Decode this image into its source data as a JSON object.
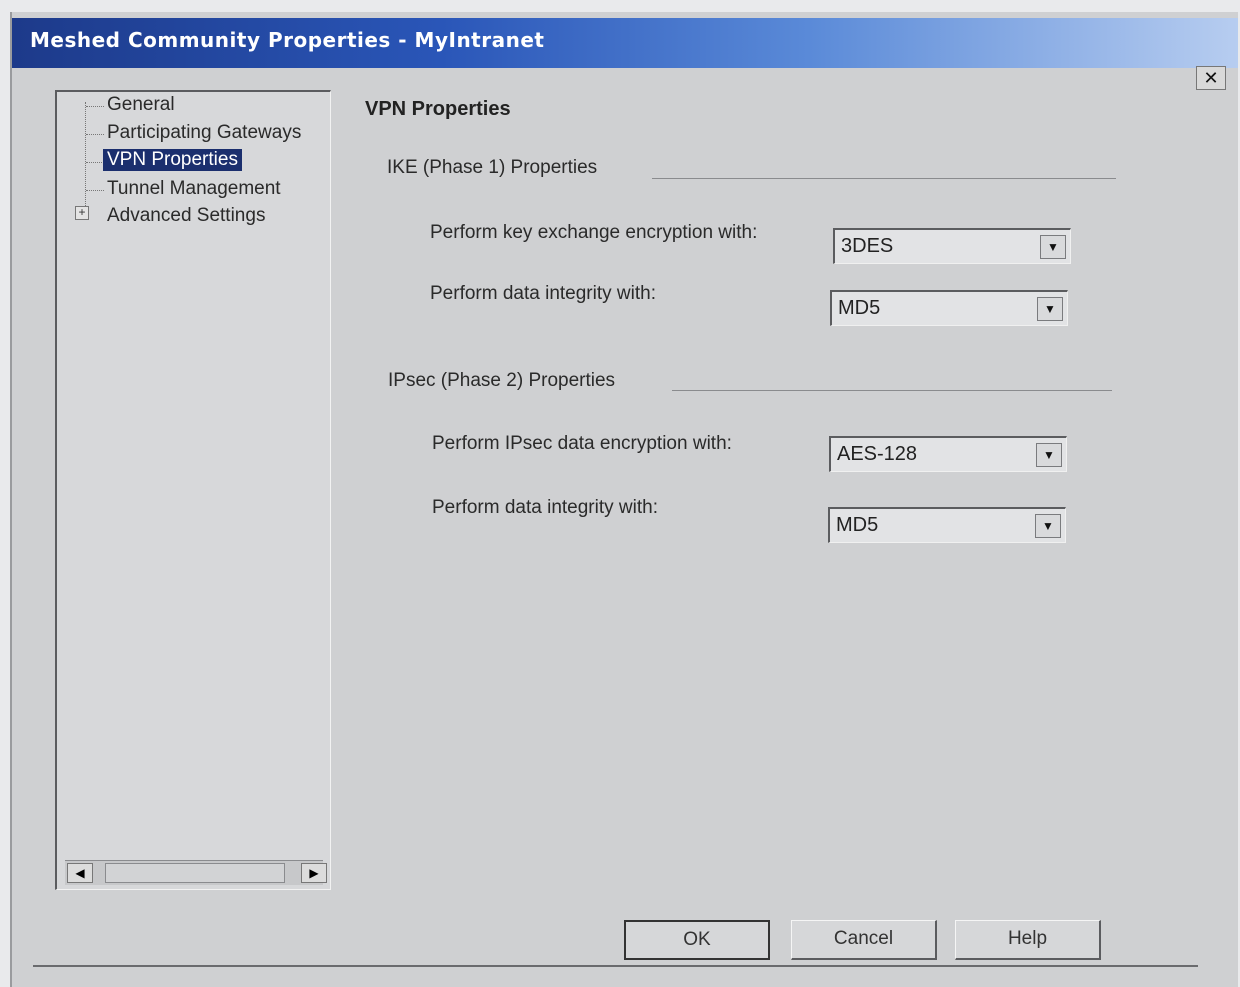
{
  "window": {
    "title": "Meshed Community Properties - MyIntranet",
    "close_label": "✕"
  },
  "tree": {
    "items": [
      {
        "label": "General"
      },
      {
        "label": "Participating Gateways"
      },
      {
        "label": "VPN Properties",
        "selected": true
      },
      {
        "label": "Tunnel Management"
      },
      {
        "label": "Advanced Settings",
        "expander": "+"
      }
    ],
    "scroll_left": "◀",
    "scroll_right": "▶"
  },
  "main": {
    "heading": "VPN Properties",
    "ike": {
      "title": "IKE (Phase 1) Properties",
      "encryption_label": "Perform key exchange encryption with:",
      "encryption_value": "3DES",
      "integrity_label": "Perform data integrity with:",
      "integrity_value": "MD5"
    },
    "ipsec": {
      "title": "IPsec (Phase 2) Properties",
      "encryption_label": "Perform IPsec data encryption with:",
      "encryption_value": "AES-128",
      "integrity_label": "Perform data integrity with:",
      "integrity_value": "MD5"
    },
    "dropdown_arrow": "▼"
  },
  "buttons": {
    "ok": "OK",
    "cancel": "Cancel",
    "help": "Help"
  }
}
